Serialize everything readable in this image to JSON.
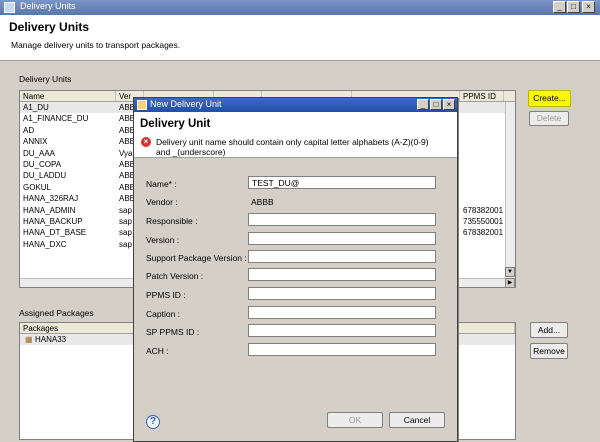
{
  "window": {
    "title": "Delivery Units",
    "minimize": "_",
    "maximize": "□",
    "close": "×"
  },
  "header": {
    "title": "Delivery Units",
    "description": "Manage delivery units to transport packages."
  },
  "delivery_units": {
    "section_label": "Delivery Units",
    "columns": [
      "Name",
      "Ver",
      "",
      "",
      "",
      "",
      "PPMS ID"
    ],
    "rows": [
      {
        "name": "A1_DU",
        "vendor": "ABB",
        "ppms": ""
      },
      {
        "name": "A1_FINANCE_DU",
        "vendor": "ABB",
        "ppms": ""
      },
      {
        "name": "AD",
        "vendor": "ABB",
        "ppms": ""
      },
      {
        "name": "ANNIX",
        "vendor": "ABB",
        "ppms": ""
      },
      {
        "name": "DU_AAA",
        "vendor": "Vya",
        "ppms": ""
      },
      {
        "name": "DU_COPA",
        "vendor": "ABB",
        "ppms": ""
      },
      {
        "name": "DU_LADDU",
        "vendor": "ABB",
        "ppms": ""
      },
      {
        "name": "GOKUL",
        "vendor": "ABB",
        "ppms": ""
      },
      {
        "name": "HANA_326RAJ",
        "vendor": "ABB",
        "ppms": ""
      },
      {
        "name": "HANA_ADMIN",
        "vendor": "sap",
        "ppms": "678382001"
      },
      {
        "name": "HANA_BACKUP",
        "vendor": "sap",
        "ppms": "735550001"
      },
      {
        "name": "HANA_DT_BASE",
        "vendor": "sap",
        "ppms": "678382001"
      },
      {
        "name": "HANA_DXC",
        "vendor": "sap",
        "ppms": ""
      }
    ],
    "create_label": "Create...",
    "delete_label": "Delete"
  },
  "assigned_packages": {
    "section_label": "Assigned Packages",
    "column": "Packages",
    "items": [
      "HANA33"
    ],
    "add_label": "Add...",
    "remove_label": "Remove"
  },
  "dialog": {
    "title": "New Delivery Unit",
    "heading": "Delivery Unit",
    "error": "Delivery unit name should contain only capital letter alphabets (A-Z)(0-9) and _(underscore)",
    "fields": {
      "name_label": "Name* :",
      "name_value": "TEST_DU@",
      "vendor_label": "Vendor :",
      "vendor_value": "ABBB",
      "responsible_label": "Responsible :",
      "version_label": "Version :",
      "spv_label": "Support Package Version :",
      "patch_label": "Patch Version :",
      "ppms_label": "PPMS ID :",
      "caption_label": "Caption :",
      "sp_ppms_label": "SP PPMS ID :",
      "ach_label": "ACH :"
    },
    "help": "?",
    "ok_label": "OK",
    "cancel_label": "Cancel"
  },
  "colors": {
    "highlight": "#f8f800",
    "dialog_title": "#2a5bb8",
    "error_icon": "#d93030"
  }
}
